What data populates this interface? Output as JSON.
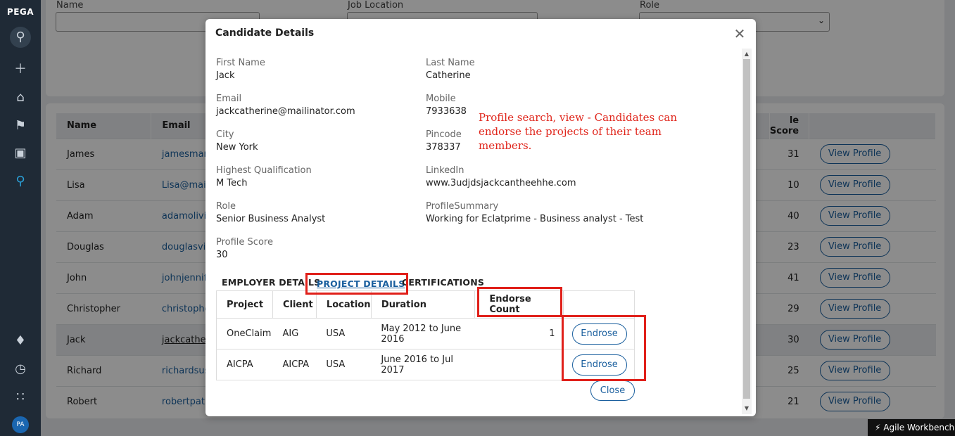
{
  "rail": {
    "brand": "PEGA",
    "avatar": "PA",
    "icons": [
      "search-icon",
      "plus-icon",
      "home-icon",
      "flag-icon",
      "briefcase-icon",
      "search-active-icon",
      "bell-icon",
      "clock-icon",
      "apps-grid-icon"
    ]
  },
  "filters": {
    "name_label": "Name",
    "job_location_label": "Job Location",
    "role_label": "Role"
  },
  "background_table": {
    "headers": [
      "Name",
      "Email",
      "le Score",
      ""
    ],
    "rows": [
      {
        "name": "James",
        "email": "jamesmary",
        "score": "31",
        "action": "View Profile"
      },
      {
        "name": "Lisa",
        "email": "Lisa@maili",
        "score": "10",
        "action": "View Profile"
      },
      {
        "name": "Adam",
        "email": "adamolivia",
        "score": "40",
        "action": "View Profile"
      },
      {
        "name": "Douglas",
        "email": "douglasvic",
        "score": "23",
        "action": "View Profile"
      },
      {
        "name": "John",
        "email": "johnjennife",
        "score": "41",
        "action": "View Profile"
      },
      {
        "name": "Christopher",
        "email": "christophe",
        "score": "29",
        "action": "View Profile"
      },
      {
        "name": "Jack",
        "email": "jackcatheri",
        "score": "30",
        "action": "View Profile"
      },
      {
        "name": "Richard",
        "email": "richardsus",
        "score": "25",
        "action": "View Profile"
      },
      {
        "name": "Robert",
        "email": "robertpatr",
        "score": "21",
        "action": "View Profile"
      }
    ]
  },
  "modal": {
    "title": "Candidate Details",
    "fields": {
      "first_name_label": "First Name",
      "first_name": "Jack",
      "last_name_label": "Last Name",
      "last_name": "Catherine",
      "email_label": "Email",
      "email": "jackcatherine@mailinator.com",
      "mobile_label": "Mobile",
      "mobile": "7933638",
      "city_label": "City",
      "city": "New York",
      "pincode_label": "Pincode",
      "pincode": "378337",
      "qualification_label": "Highest Qualification",
      "qualification": "M Tech",
      "linkedin_label": "LinkedIn",
      "linkedin": "www.3udjdsjackcantheehhe.com",
      "role_label": "Role",
      "role": "Senior Business Analyst",
      "summary_label": "ProfileSummary",
      "summary": "Working for Eclatprime - Business analyst - Test",
      "score_label": "Profile Score",
      "score": "30"
    },
    "annotation": "Profile search, view - Candidates can endorse the projects of their team members.",
    "tabs": {
      "employer": "EMPLOYER DETAILS",
      "project": "PROJECT DETAILS",
      "certifications": "CERTIFICATIONS"
    },
    "projects": {
      "headers": [
        "Project",
        "Client",
        "Location",
        "Duration",
        "Endorse Count",
        ""
      ],
      "rows": [
        {
          "project": "OneClaim",
          "client": "AIG",
          "location": "USA",
          "duration": "May 2012 to June 2016",
          "count": "1",
          "action": "Endrose"
        },
        {
          "project": "AICPA",
          "client": "AICPA",
          "location": "USA",
          "duration": "June 2016 to Jul 2017",
          "count": "",
          "action": "Endrose"
        }
      ]
    },
    "close_label": "Close"
  },
  "toast": {
    "label": "Agile Workbench"
  },
  "colors": {
    "accent": "#1a5f9e",
    "annotation_red": "#e0201a",
    "rail": "#1f2a36"
  }
}
